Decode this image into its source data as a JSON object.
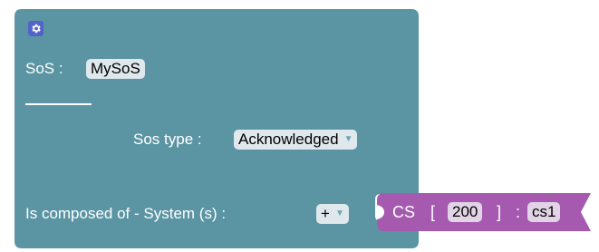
{
  "colors": {
    "sos_block": "#5b95a4",
    "cs_block": "#a55ab0",
    "field_bg": "#dfe8ec",
    "cs_field_bg": "#e2d4e6",
    "gear_bg": "#5263c9",
    "label_text": "#ffffff"
  },
  "sos_block": {
    "mutator_icon": "gear-icon",
    "sos_label": "SoS :",
    "sos_name": "MySoS",
    "sos_type_label": "Sos type :",
    "sos_type_value": "Acknowledged",
    "composed_label": "Is composed of - System (s) :",
    "add_value": "+"
  },
  "cs_block": {
    "cs_label": "CS",
    "open_bracket": "[",
    "cs_count": "200",
    "close_bracket": "]",
    "colon": ":",
    "cs_name": "cs1"
  }
}
